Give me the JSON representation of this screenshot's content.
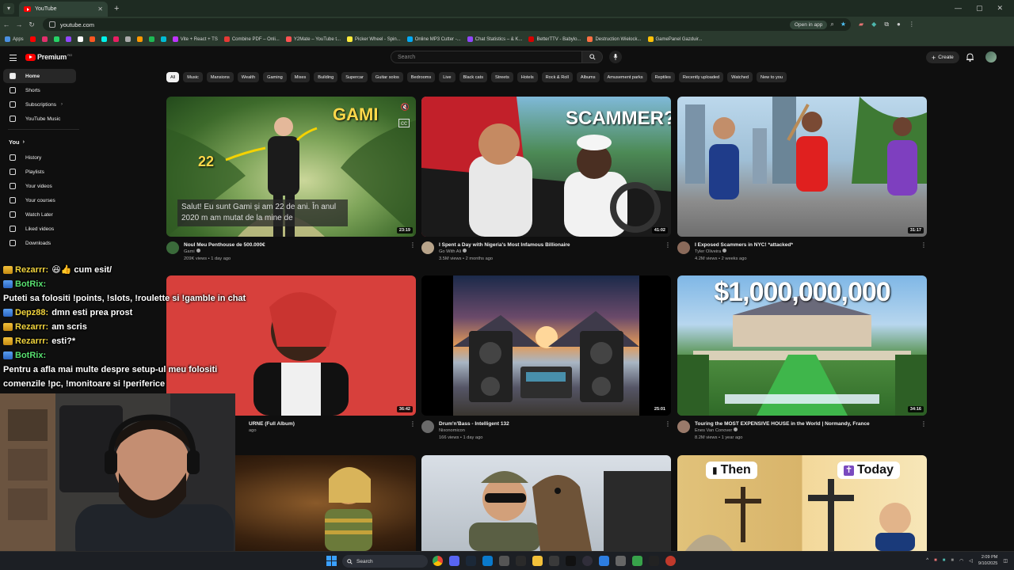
{
  "browser": {
    "tab_title": "YouTube",
    "url": "youtube.com",
    "open_in_app": "Open in app",
    "bookmarks": [
      {
        "label": "Apps",
        "color": "#4a90e2"
      },
      {
        "label": "",
        "color": "#ff0000"
      },
      {
        "label": "",
        "color": "#e1306c"
      },
      {
        "label": "",
        "color": "#25d366"
      },
      {
        "label": "",
        "color": "#9146ff"
      },
      {
        "label": "",
        "color": "#ffffff"
      },
      {
        "label": "",
        "color": "#ff5722"
      },
      {
        "label": "",
        "color": "#00f2ea"
      },
      {
        "label": "",
        "color": "#e91e63"
      },
      {
        "label": "",
        "color": "#aaaaaa"
      },
      {
        "label": "",
        "color": "#ff9800"
      },
      {
        "label": "",
        "color": "#1db954"
      },
      {
        "label": "",
        "color": "#00bcd4"
      },
      {
        "label": "Vite + React + TS",
        "color": "#bd34fe"
      },
      {
        "label": "Combine PDF – Onli...",
        "color": "#e53935"
      },
      {
        "label": "Y2Mate – YouTube t...",
        "color": "#ff5252"
      },
      {
        "label": "Picker Wheel - Spin...",
        "color": "#ffeb3b"
      },
      {
        "label": "Online MP3 Cutter -...",
        "color": "#03a9f4"
      },
      {
        "label": "Chat Statistics – & K...",
        "color": "#9146ff"
      },
      {
        "label": "BetterTTV - Babylo...",
        "color": "#d50000"
      },
      {
        "label": "Destruction Wielock...",
        "color": "#ff7043"
      },
      {
        "label": "GamePanel Gazduir...",
        "color": "#ffc107"
      }
    ]
  },
  "header": {
    "logo_text": "Premium",
    "logo_region": "RO",
    "search_placeholder": "Search",
    "create_label": "Create"
  },
  "sidebar": {
    "top": [
      {
        "label": "Home",
        "active": true
      },
      {
        "label": "Shorts"
      },
      {
        "label": "Subscriptions",
        "chevron": true
      },
      {
        "label": "YouTube Music"
      }
    ],
    "you_label": "You",
    "you": [
      {
        "label": "History"
      },
      {
        "label": "Playlists"
      },
      {
        "label": "Your videos"
      },
      {
        "label": "Your courses"
      },
      {
        "label": "Watch Later"
      },
      {
        "label": "Liked videos"
      },
      {
        "label": "Downloads"
      }
    ]
  },
  "chips": [
    "All",
    "Music",
    "Mansions",
    "Wealth",
    "Gaming",
    "Mixes",
    "Building",
    "Supercar",
    "Guitar solos",
    "Bedrooms",
    "Live",
    "Black cats",
    "Streets",
    "Hotels",
    "Rock & Roll",
    "Albums",
    "Amusement parks",
    "Reptiles",
    "Recently uploaded",
    "Watched",
    "New to you"
  ],
  "videos": [
    {
      "title": "Noul Meu Penthouse de 500.000€",
      "channel": "Gami",
      "stats": "209K views • 1 day ago",
      "duration": "23:19",
      "overlay": "GAMI",
      "caption": "Salut! Eu sunt Gami și am 22 de ani. În anul 2020 m am mutat de la mine de",
      "num": "22"
    },
    {
      "title": "I Spent a Day with Nigeria's Most Infamous Billionaire",
      "channel": "Go With Ali",
      "stats": "3.5M views • 2 months ago",
      "duration": "41:02",
      "overlay": "SCAMMER?"
    },
    {
      "title": "I Exposed Scammers in NYC! *attacked*",
      "channel": "Tyler Oliveira",
      "stats": "4.2M views • 2 weeks ago",
      "duration": "31:17"
    },
    {
      "title": "URNE (Full Album)",
      "channel": "",
      "stats": "ago",
      "duration": "36:42"
    },
    {
      "title": "Drum'n'Bass - Intelligent 132",
      "channel": "Nixonomicon",
      "stats": "166 views • 1 day ago",
      "duration": "25:01"
    },
    {
      "title": "Touring the MOST EXPENSIVE HOUSE in the World | Normandy, France",
      "channel": "Enes Van Conover",
      "stats": "8.2M views • 1 year ago",
      "duration": "34:16",
      "overlay": "$1,000,000,000"
    },
    {
      "title": "",
      "channel": "",
      "stats": "",
      "duration": ""
    },
    {
      "title": "",
      "channel": "",
      "stats": "",
      "duration": ""
    },
    {
      "title": "",
      "channel": "",
      "stats": "",
      "duration": "",
      "overlay_left": "Then",
      "overlay_right": "Today"
    }
  ],
  "chat": [
    {
      "user": "Rezarrr:",
      "bot": false,
      "badge": "crown",
      "text": "😆👍 cum esit/"
    },
    {
      "user": "BotRix:",
      "bot": true,
      "badge": "wrench",
      "text": "Puteti sa folositi !points, !slots, !roulette si !gamble in chat"
    },
    {
      "user": "Depz88:",
      "bot": false,
      "badge": "wrench",
      "text": "dmn esti prea prost"
    },
    {
      "user": "Rezarrr:",
      "bot": false,
      "badge": "crown",
      "text": "am scris"
    },
    {
      "user": "Rezarrr:",
      "bot": false,
      "badge": "crown",
      "text": "esti?*"
    },
    {
      "user": "BotRix:",
      "bot": true,
      "badge": "wrench",
      "text": "Pentru a afla mai multe despre setup-ul meu folositi comenzile !pc, !monitoare si !periferice"
    }
  ],
  "taskbar": {
    "search_label": "Search",
    "time": "2:09 PM",
    "date": "9/10/2025"
  }
}
